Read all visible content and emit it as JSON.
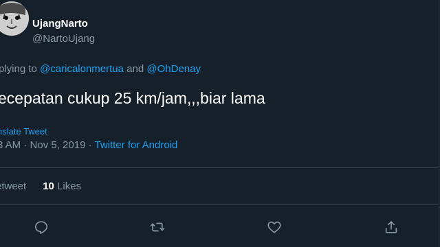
{
  "author": {
    "display_name": "UjangNarto",
    "handle": "@NartoUjang"
  },
  "reply": {
    "prefix": "plying to ",
    "mention_1": "@caricalonmertua",
    "joiner": " and ",
    "mention_2": "@OhDenay"
  },
  "tweet": {
    "text": "ecepatan cukup 25 km/jam,,,biar lama",
    "translate_label": "nslate Tweet",
    "time": "3 AM",
    "sep_1": " · ",
    "date": "Nov 5, 2019",
    "sep_2": " · ",
    "source": "Twitter for Android"
  },
  "stats": {
    "retweets_label": "etweet",
    "likes_count": "10",
    "likes_label": " Likes"
  },
  "actions": {
    "icons": [
      "reply-icon",
      "retweet-icon",
      "like-icon",
      "share-icon"
    ]
  },
  "colors": {
    "background": "#15202b",
    "accent": "#1da1f2",
    "muted": "#8899a6",
    "divider": "#38444d",
    "text": "#ffffff"
  }
}
